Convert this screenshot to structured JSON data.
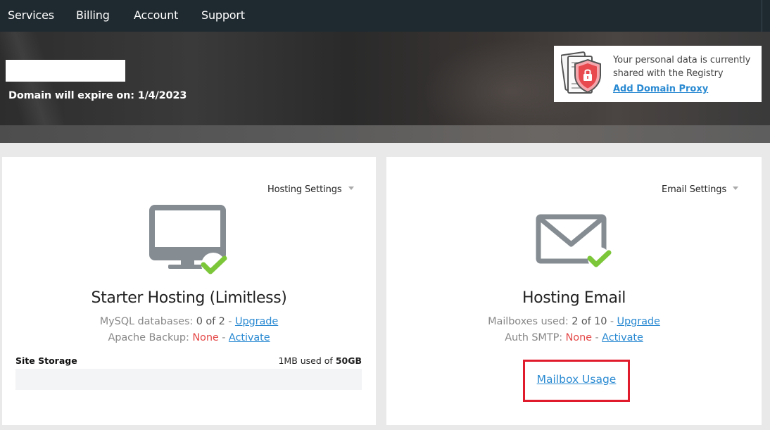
{
  "nav": {
    "items": [
      {
        "label": "Services"
      },
      {
        "label": "Billing"
      },
      {
        "label": "Account"
      },
      {
        "label": "Support"
      }
    ]
  },
  "hero": {
    "domain_name": "",
    "expire_text": "Domain will expire on: 1/4/2023"
  },
  "privacy": {
    "message": "Your personal data is currently shared with the Registry",
    "link_label": "Add Domain Proxy",
    "icon": "shield-lock-document-icon"
  },
  "hosting": {
    "settings_label": "Hosting Settings",
    "icon": "monitor-check-icon",
    "title": "Starter Hosting (Limitless)",
    "mysql_label": "MySQL databases:",
    "mysql_value": "0 of 2",
    "mysql_sep": " - ",
    "mysql_link": "Upgrade",
    "backup_label": "Apache Backup:",
    "backup_value": "None",
    "backup_sep": " - ",
    "backup_link": "Activate",
    "storage_label": "Site Storage",
    "storage_used": "1MB used of",
    "storage_total": "50GB",
    "storage_fraction": 2e-05
  },
  "email": {
    "settings_label": "Email Settings",
    "icon": "envelope-check-icon",
    "title": "Hosting Email",
    "mailboxes_label": "Mailboxes used:",
    "mailboxes_value": "2 of 10",
    "mailboxes_sep": " - ",
    "mailboxes_link": "Upgrade",
    "smtp_label": "Auth SMTP:",
    "smtp_value": "None",
    "smtp_sep": " - ",
    "smtp_link": "Activate",
    "mailbox_usage_link": "Mailbox Usage"
  },
  "colors": {
    "nav_bg": "#1f2a30",
    "link": "#2a8ad2",
    "none_red": "#e54848",
    "check_green": "#7cc63a",
    "icon_gray": "#858c92",
    "highlight_red": "#e01b2b"
  }
}
